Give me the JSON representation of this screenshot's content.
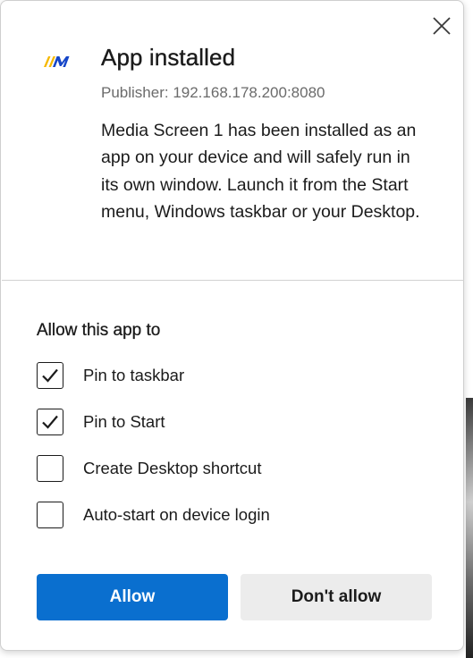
{
  "dialog": {
    "logo_text": "//M",
    "title": "App installed",
    "publisher": "Publisher: 192.168.178.200:8080",
    "description": "Media Screen 1 has been installed as an app on your device and will safely run in its own window. Launch it from the Start menu, Windows taskbar or your Desktop."
  },
  "permissions": {
    "title": "Allow this app to",
    "options": [
      {
        "label": "Pin to taskbar",
        "checked": true
      },
      {
        "label": "Pin to Start",
        "checked": true
      },
      {
        "label": "Create Desktop shortcut",
        "checked": false
      },
      {
        "label": "Auto-start on device login",
        "checked": false
      }
    ]
  },
  "buttons": {
    "allow": "Allow",
    "deny": "Don't allow"
  },
  "colors": {
    "accent": "#0a6fcf",
    "logo_yellow": "#f5b800",
    "logo_blue": "#1646c8"
  },
  "icons": {
    "close": "close-icon",
    "check": "checkmark-icon"
  }
}
